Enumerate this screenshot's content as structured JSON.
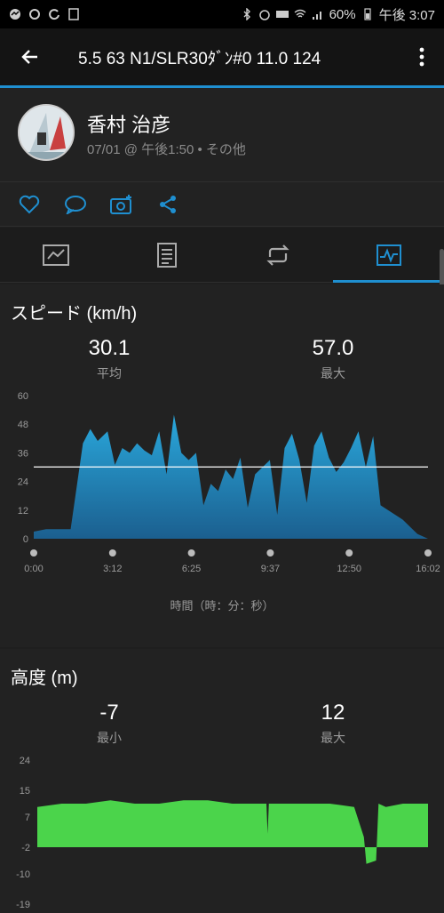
{
  "status_bar": {
    "battery": "60%",
    "time": "午後 3:07"
  },
  "appbar": {
    "title": "5.5  63  N1/SLR30ﾀﾞﾝ#0  11.0  124"
  },
  "profile": {
    "name": "香村 治彦",
    "meta": "07/01 @ 午後1:50 • その他"
  },
  "speed": {
    "title": "スピード (km/h)",
    "avg_value": "30.1",
    "avg_label": "平均",
    "max_value": "57.0",
    "max_label": "最大",
    "xlabel": "時間（時：分：秒）"
  },
  "altitude": {
    "title": "高度 (m)",
    "min_value": "-7",
    "min_label": "最小",
    "max_value": "12",
    "max_label": "最大"
  },
  "colors": {
    "accent": "#1f8fd0",
    "speed_fill_top": "#2aa8dc",
    "speed_fill_bottom": "#1b5f8f",
    "altitude_fill": "#4bd44b"
  },
  "chart_data": [
    {
      "type": "area",
      "title": "スピード (km/h)",
      "xlabel": "時間（時：分：秒）",
      "x_ticks": [
        "0:00",
        "3:12",
        "6:25",
        "9:37",
        "12:50",
        "16:02"
      ],
      "y_ticks": [
        0,
        12,
        24,
        36,
        48,
        60
      ],
      "ylim": [
        0,
        60
      ],
      "average_line": 30.1,
      "x_minutes": [
        0,
        0.5,
        1,
        1.5,
        2.0,
        2.3,
        2.6,
        3.0,
        3.3,
        3.6,
        3.9,
        4.2,
        4.5,
        4.8,
        5.1,
        5.4,
        5.7,
        6.0,
        6.3,
        6.6,
        6.9,
        7.2,
        7.5,
        7.8,
        8.1,
        8.4,
        8.7,
        9.0,
        9.3,
        9.6,
        9.9,
        10.2,
        10.5,
        10.8,
        11.1,
        11.4,
        11.7,
        12.0,
        12.3,
        12.6,
        12.9,
        13.2,
        13.5,
        13.8,
        14.1,
        14.4,
        14.7,
        15.0,
        15.3,
        15.6,
        16.03
      ],
      "values": [
        3,
        4,
        4,
        4,
        40,
        46,
        41,
        45,
        31,
        38,
        36,
        40,
        37,
        35,
        45,
        27,
        52,
        36,
        33,
        36,
        14,
        23,
        20,
        29,
        25,
        34,
        13,
        27,
        30,
        33,
        10,
        38,
        44,
        33,
        15,
        39,
        45,
        34,
        28,
        32,
        38,
        45,
        30,
        43,
        14,
        12,
        10,
        8,
        5,
        2,
        0
      ]
    },
    {
      "type": "area",
      "title": "高度 (m)",
      "y_ticks": [
        -19,
        -10,
        -2,
        7,
        15,
        24
      ],
      "ylim": [
        -19,
        24
      ],
      "x_minutes": [
        0,
        1,
        2,
        3,
        4,
        5,
        6,
        7,
        8,
        9,
        9.4,
        9.45,
        9.5,
        10,
        11,
        12,
        13,
        13.4,
        13.5,
        13.9,
        14.0,
        14.3,
        15,
        16.03
      ],
      "values": [
        10,
        11,
        11,
        12,
        11,
        11,
        12,
        12,
        11,
        11,
        11,
        2,
        11,
        11,
        11,
        11,
        10,
        1,
        -7,
        -6,
        11,
        10,
        11,
        11
      ]
    }
  ]
}
